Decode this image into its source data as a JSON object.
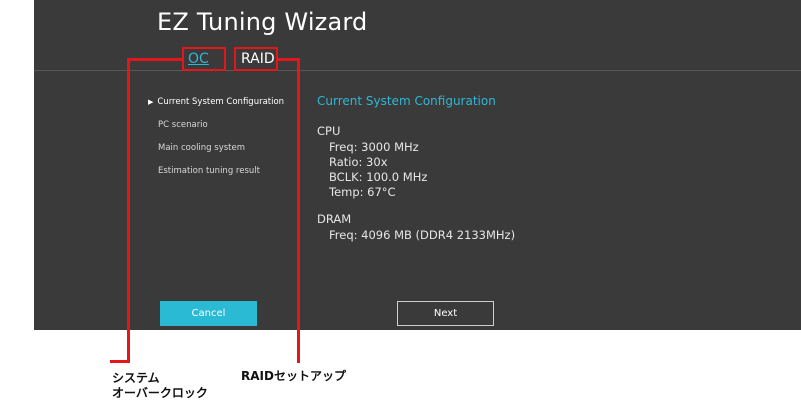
{
  "wizard": {
    "title": "EZ Tuning Wizard"
  },
  "tabs": [
    {
      "label": "OC"
    },
    {
      "label": "RAID"
    }
  ],
  "sidebar": {
    "items": [
      {
        "label": "Current System Configuration",
        "selected": true
      },
      {
        "label": "PC scenario"
      },
      {
        "label": "Main cooling system"
      },
      {
        "label": "Estimation tuning result"
      }
    ]
  },
  "content": {
    "heading": "Current System Configuration",
    "cpu": {
      "title": "CPU",
      "freq": "Freq: 3000 MHz",
      "ratio": "Ratio: 30x",
      "bclk": "BCLK: 100.0 MHz",
      "temp": "Temp: 67°C"
    },
    "dram": {
      "title": "DRAM",
      "freq": "Freq: 4096 MB (DDR4 2133MHz)"
    }
  },
  "buttons": {
    "cancel": "Cancel",
    "next": "Next"
  },
  "annotations": {
    "oc_label_line1": "システム",
    "oc_label_line2": "オーバークロック",
    "raid_label": "RAIDセットアップ"
  },
  "colors": {
    "accent": "#2fb7d6",
    "panel": "#3a3a3a",
    "callout": "#e2161b"
  }
}
